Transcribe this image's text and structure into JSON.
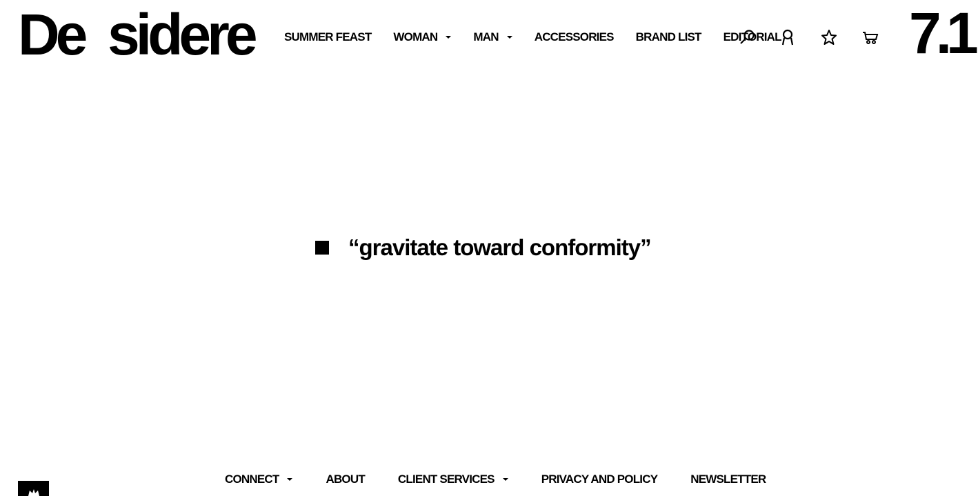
{
  "header": {
    "logo": "De  sidere",
    "nav": [
      {
        "label": "SUMMER FEAST",
        "dropdown": false
      },
      {
        "label": "WOMAN",
        "dropdown": true
      },
      {
        "label": "MAN",
        "dropdown": true
      },
      {
        "label": "ACCESSORIES",
        "dropdown": false
      },
      {
        "label": "BRAND LIST",
        "dropdown": false
      },
      {
        "label": "EDITORIAL",
        "dropdown": false
      }
    ],
    "icons": [
      "search-icon",
      "account-icon",
      "wishlist-star-icon",
      "cart-icon"
    ],
    "badge": "7.1"
  },
  "main": {
    "quote": "“gravitate toward conformity”"
  },
  "footer": {
    "nav": [
      {
        "label": "CONNECT",
        "dropdown": true
      },
      {
        "label": "ABOUT",
        "dropdown": false
      },
      {
        "label": "CLIENT SERVICES",
        "dropdown": true
      },
      {
        "label": "PRIVACY AND POLICY",
        "dropdown": false
      },
      {
        "label": "NEWSLETTER",
        "dropdown": false
      }
    ],
    "badge_icon": "crown-icon"
  },
  "colors": {
    "background": "#ffffff",
    "text": "#000000"
  }
}
